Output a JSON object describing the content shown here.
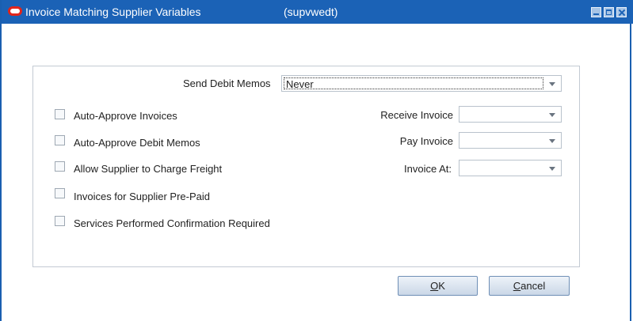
{
  "window": {
    "title": "Invoice Matching Supplier Variables",
    "code": "(supvwedt)"
  },
  "form": {
    "send_debit_memos": {
      "label": "Send Debit Memos",
      "value": "Never"
    },
    "checkboxes": [
      {
        "label": "Auto-Approve Invoices",
        "checked": false
      },
      {
        "label": "Auto-Approve Debit Memos",
        "checked": false
      },
      {
        "label": "Allow Supplier to Charge Freight",
        "checked": false
      },
      {
        "label": "Invoices for Supplier Pre-Paid",
        "checked": false
      },
      {
        "label": "Services Performed Confirmation Required",
        "checked": false
      }
    ],
    "receive_invoice": {
      "label": "Receive Invoice",
      "value": ""
    },
    "pay_invoice": {
      "label": "Pay Invoice",
      "value": ""
    },
    "invoice_at": {
      "label": "Invoice At:",
      "value": ""
    }
  },
  "buttons": {
    "ok": {
      "mnemonic": "O",
      "rest": "K"
    },
    "cancel": {
      "mnemonic": "C",
      "rest": "ancel"
    }
  },
  "colors": {
    "titlebar": "#1b62b6",
    "oracle_logo": "#e1251b"
  }
}
